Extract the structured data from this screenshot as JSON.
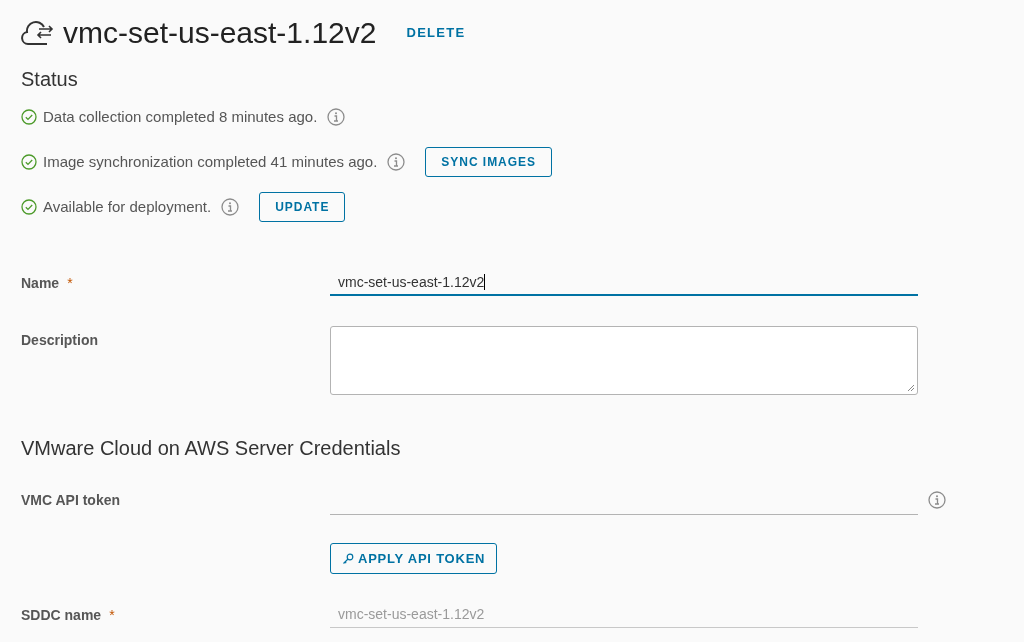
{
  "header": {
    "title": "vmc-set-us-east-1.12v2",
    "action": "DELETE"
  },
  "status": {
    "heading": "Status",
    "items": [
      {
        "text": "Data collection completed 8 minutes ago.",
        "ok": true
      },
      {
        "text": "Image synchronization completed 41 minutes ago.",
        "ok": true,
        "button": "SYNC IMAGES"
      },
      {
        "text": "Available for deployment.",
        "ok": true,
        "button": "UPDATE"
      }
    ]
  },
  "fields": [
    {
      "kind": "text",
      "label": "Name",
      "required_mark": "*",
      "value": "vmc-set-us-east-1.12v2",
      "focused": true,
      "disabled": false
    },
    {
      "kind": "textarea",
      "label": "Description"
    }
  ],
  "credentials": {
    "heading": "VMware Cloud on AWS Server Credentials",
    "fields": [
      {
        "kind": "token",
        "label": "VMC API token"
      },
      {
        "kind": "button",
        "label": "APPLY API TOKEN"
      },
      {
        "kind": "text",
        "label": "SDDC name",
        "required_mark": "*",
        "value": "vmc-set-us-east-1.12v2",
        "focused": false,
        "disabled": true
      }
    ]
  }
}
